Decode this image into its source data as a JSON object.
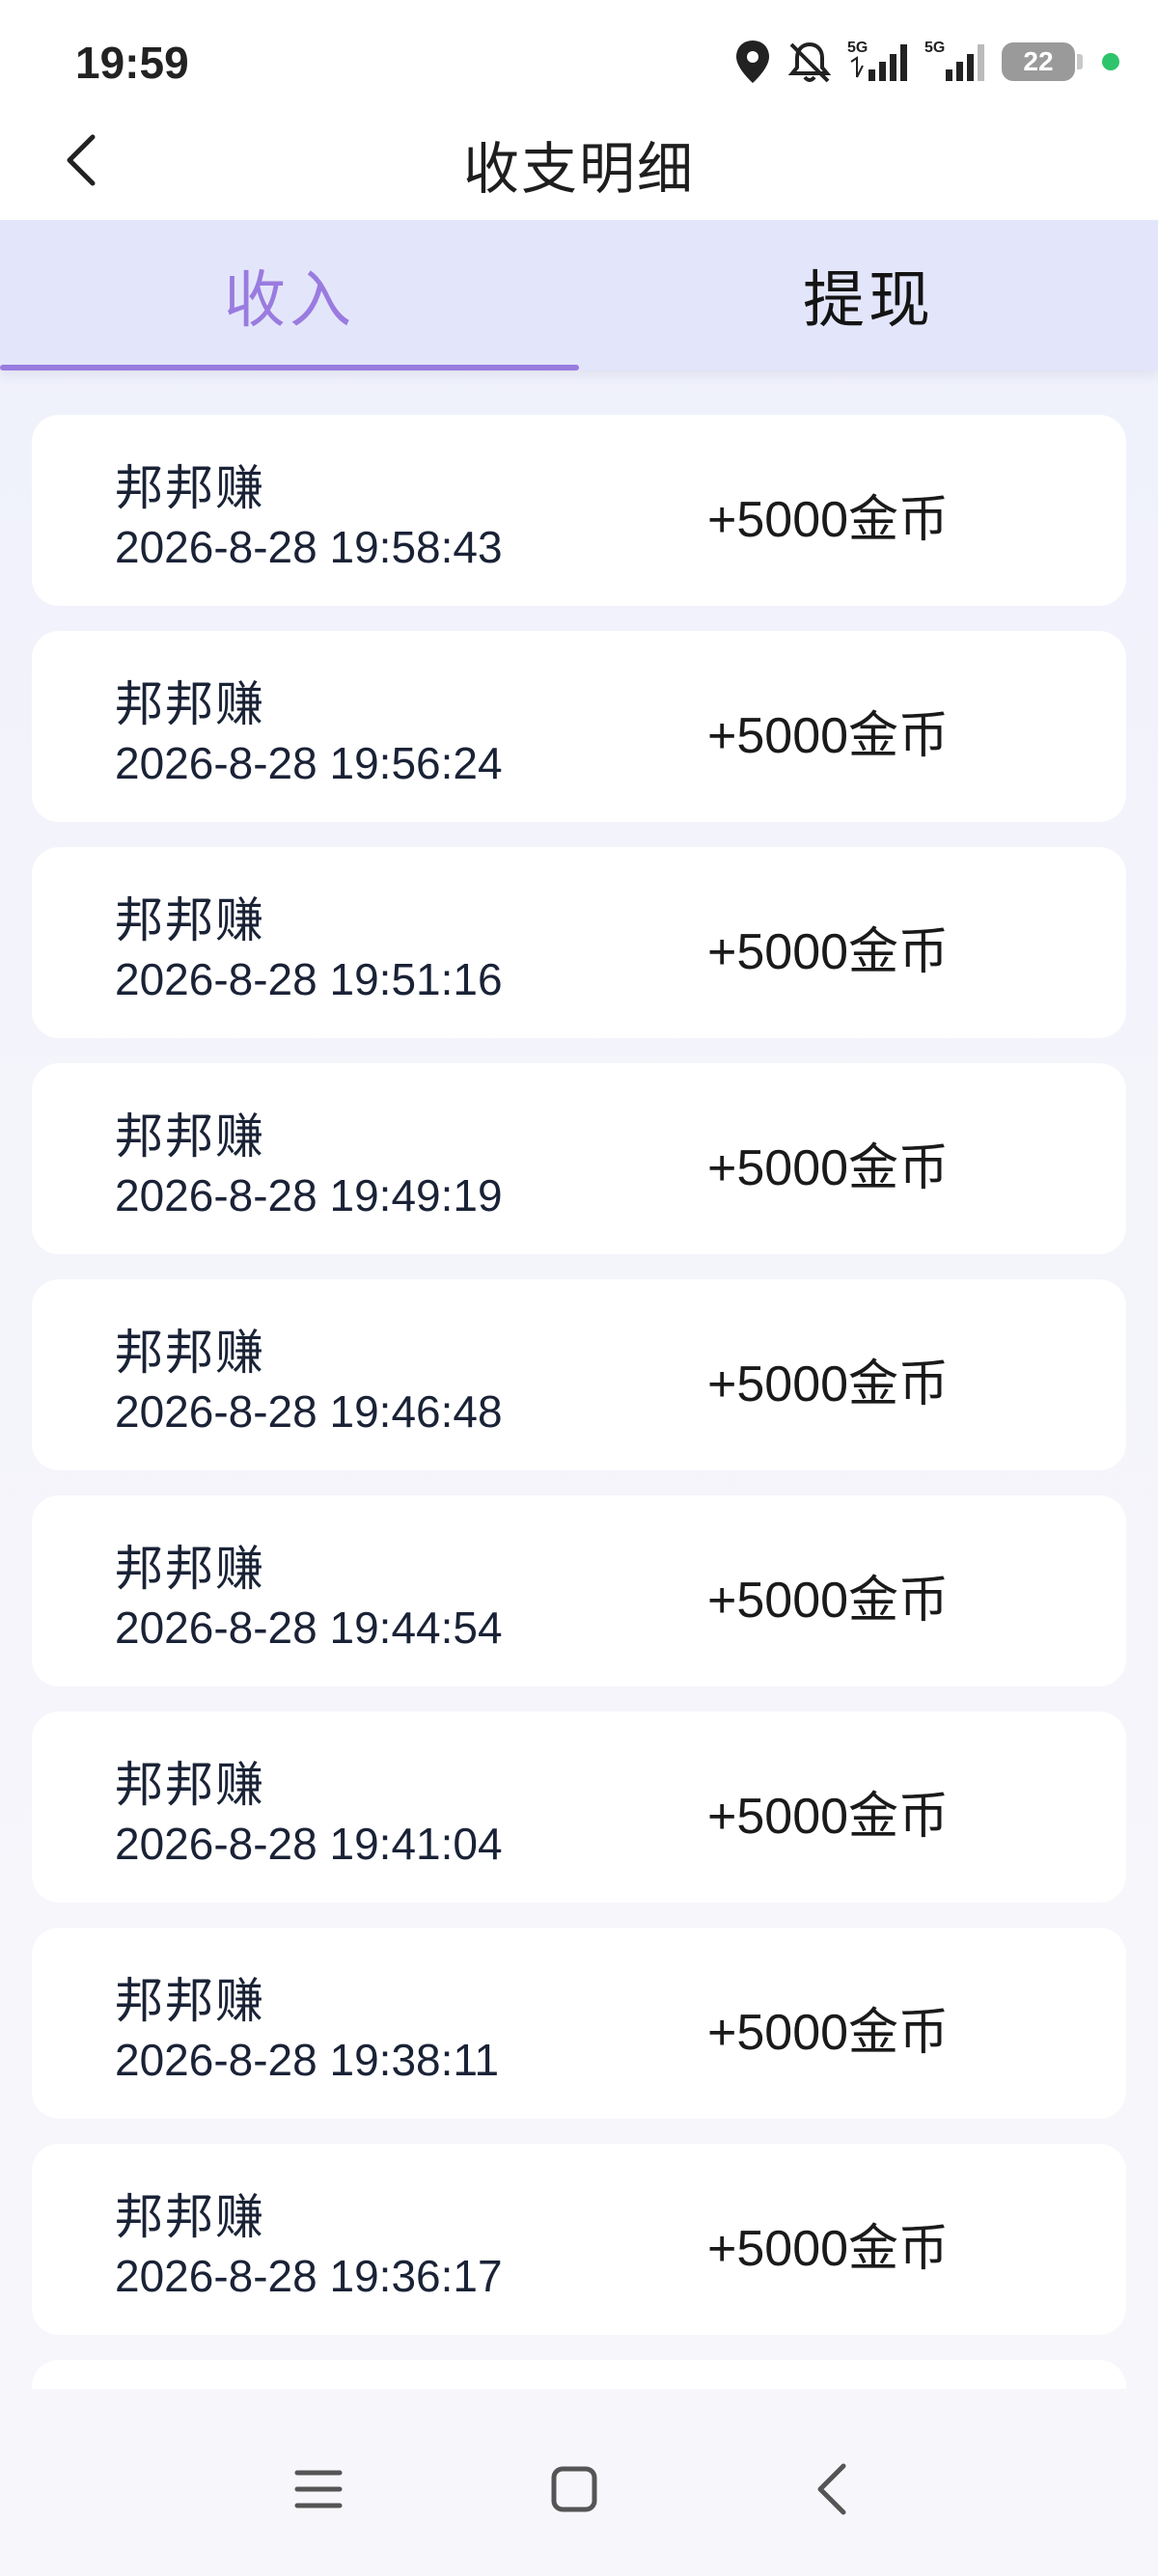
{
  "status_bar": {
    "time": "19:59",
    "network_1": "5G",
    "network_2": "5G",
    "battery": "22",
    "icons": [
      "location-icon",
      "mute-icon",
      "signal-icon",
      "signal-icon",
      "battery-icon",
      "charging-dot-icon"
    ]
  },
  "header": {
    "title": "收支明细",
    "back_icon": "chevron-left-icon"
  },
  "tabs": [
    {
      "label": "收入",
      "active": true
    },
    {
      "label": "提现",
      "active": false
    }
  ],
  "colors": {
    "accent": "#9a7be0",
    "tab_bg": "#e3e6fa",
    "page_bg": "#f2f3fb",
    "card_bg": "#ffffff",
    "text": "#1a2236"
  },
  "records": [
    {
      "source": "邦邦赚",
      "time": "2026-8-28 19:58:43",
      "amount": "+5000金币"
    },
    {
      "source": "邦邦赚",
      "time": "2026-8-28 19:56:24",
      "amount": "+5000金币"
    },
    {
      "source": "邦邦赚",
      "time": "2026-8-28 19:51:16",
      "amount": "+5000金币"
    },
    {
      "source": "邦邦赚",
      "time": "2026-8-28 19:49:19",
      "amount": "+5000金币"
    },
    {
      "source": "邦邦赚",
      "time": "2026-8-28 19:46:48",
      "amount": "+5000金币"
    },
    {
      "source": "邦邦赚",
      "time": "2026-8-28 19:44:54",
      "amount": "+5000金币"
    },
    {
      "source": "邦邦赚",
      "time": "2026-8-28 19:41:04",
      "amount": "+5000金币"
    },
    {
      "source": "邦邦赚",
      "time": "2026-8-28 19:38:11",
      "amount": "+5000金币"
    },
    {
      "source": "邦邦赚",
      "time": "2026-8-28 19:36:17",
      "amount": "+5000金币"
    }
  ],
  "system_nav": {
    "icons": [
      "menu-icon",
      "home-icon",
      "back-icon"
    ]
  }
}
